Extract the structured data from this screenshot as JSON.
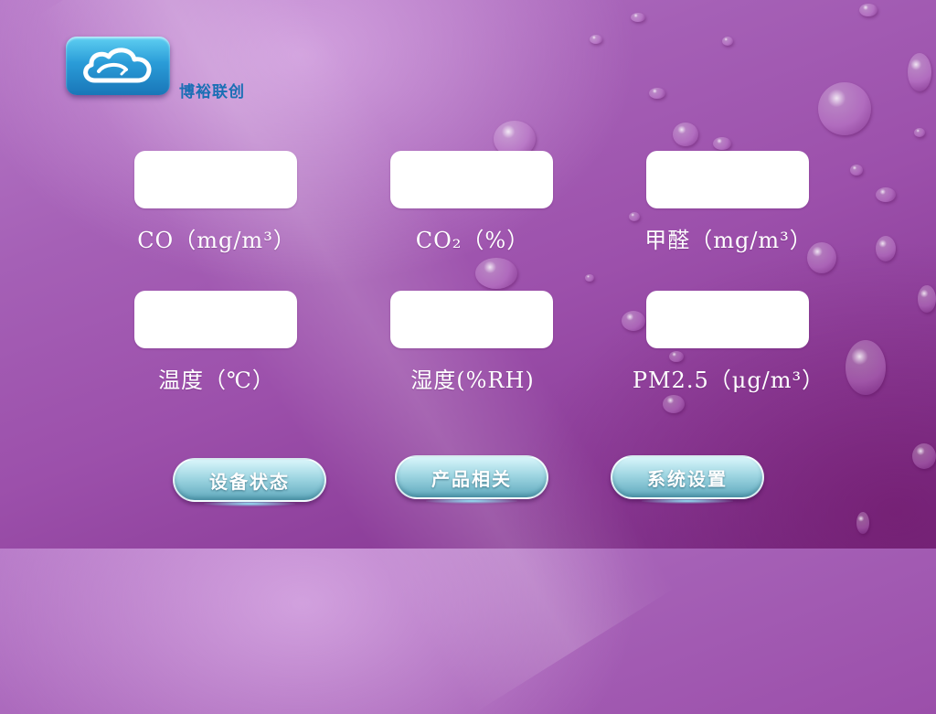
{
  "brand": {
    "name": "博裕联创"
  },
  "readouts": [
    {
      "label": "CO（mg/m³）",
      "value": ""
    },
    {
      "label": "CO₂（%）",
      "value": ""
    },
    {
      "label": "甲醛（mg/m³）",
      "value": ""
    },
    {
      "label": "温度（℃）",
      "value": ""
    },
    {
      "label": "湿度(%RH)",
      "value": ""
    },
    {
      "label": "PM2.5（μg/m³）",
      "value": ""
    }
  ],
  "buttons": {
    "device_status": "设备状态",
    "product_related": "产品相关",
    "system_settings": "系统设置"
  },
  "colors": {
    "accent": "#1a6fb5",
    "button": "#9fd6e2",
    "background": "#a560b6"
  }
}
